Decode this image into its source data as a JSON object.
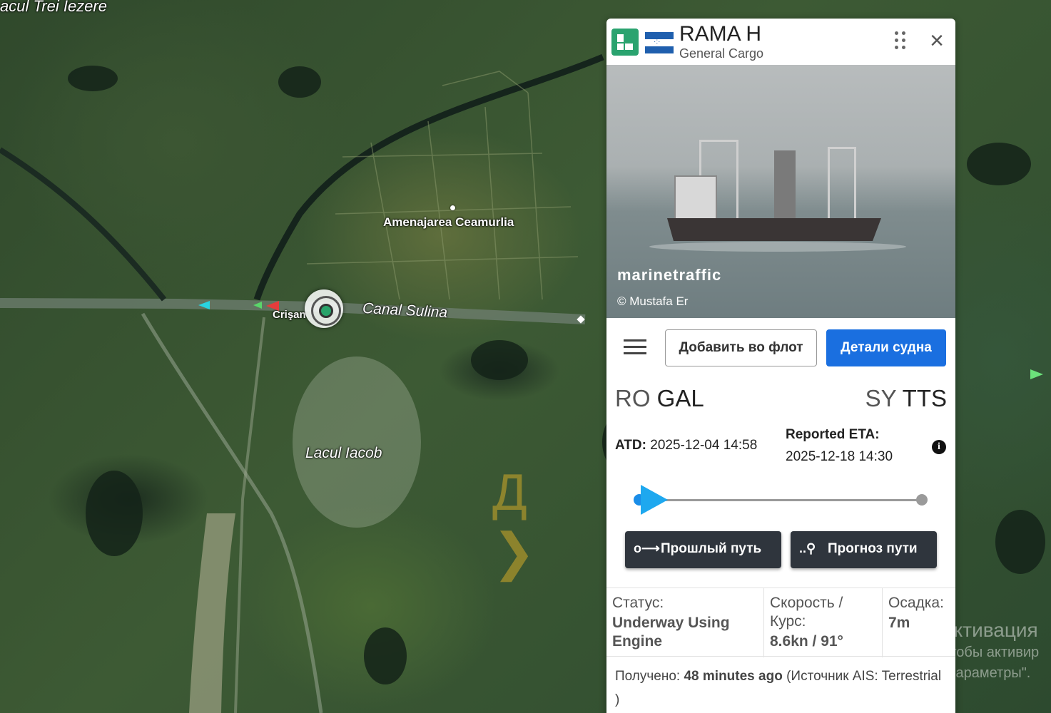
{
  "map": {
    "labels": {
      "trei_iezere": "acul Trei Iezere",
      "ceamurlia": "Amenajarea Ceamurlia",
      "canal": "Canal Sulina",
      "crisan": "Crişan",
      "lacul_iacob": "Lacul Iacob"
    },
    "overlay_glyph": "Д ❯"
  },
  "panel": {
    "vessel_name": "RAMA H",
    "vessel_type": "General Cargo",
    "flag": "honduras-flag",
    "photo": {
      "brand": "marinetraffic",
      "credit": "© Mustafa Er"
    },
    "buttons": {
      "add_to_fleet": "Добавить во флот",
      "vessel_details": "Детали судна",
      "past_track": "Прошлый путь",
      "route_forecast": "Прогноз пути"
    },
    "route": {
      "from_country": "RO",
      "from_port": "GAL",
      "to_country": "SY",
      "to_port": "TTS"
    },
    "times": {
      "atd_label": "ATD:",
      "atd_value": "2025-12-04 14:58",
      "eta_label": "Reported ETA:",
      "eta_value": "2025-12-18 14:30"
    },
    "progress_fraction": 0.03,
    "stats": {
      "status_label": "Статус:",
      "status_value": "Underway Using Engine",
      "speed_label": "Скорость / Курс:",
      "speed_value": "8.6kn / 91°",
      "draught_label": "Осадка:",
      "draught_value": "7m"
    },
    "received": {
      "label": "Получено:",
      "value": "48 minutes ago",
      "source_prefix": "(Источник AIS:",
      "source_value": "Terrestrial )"
    }
  },
  "watermark": {
    "title": "Активация",
    "line1": "Чтобы активир",
    "line2": "\"Параметры\"."
  },
  "colors": {
    "primary_button": "#1a6fe0",
    "dark_button": "#2f353d",
    "progress": "#1a8de8",
    "ship_icon_bg": "#2aa36f"
  }
}
